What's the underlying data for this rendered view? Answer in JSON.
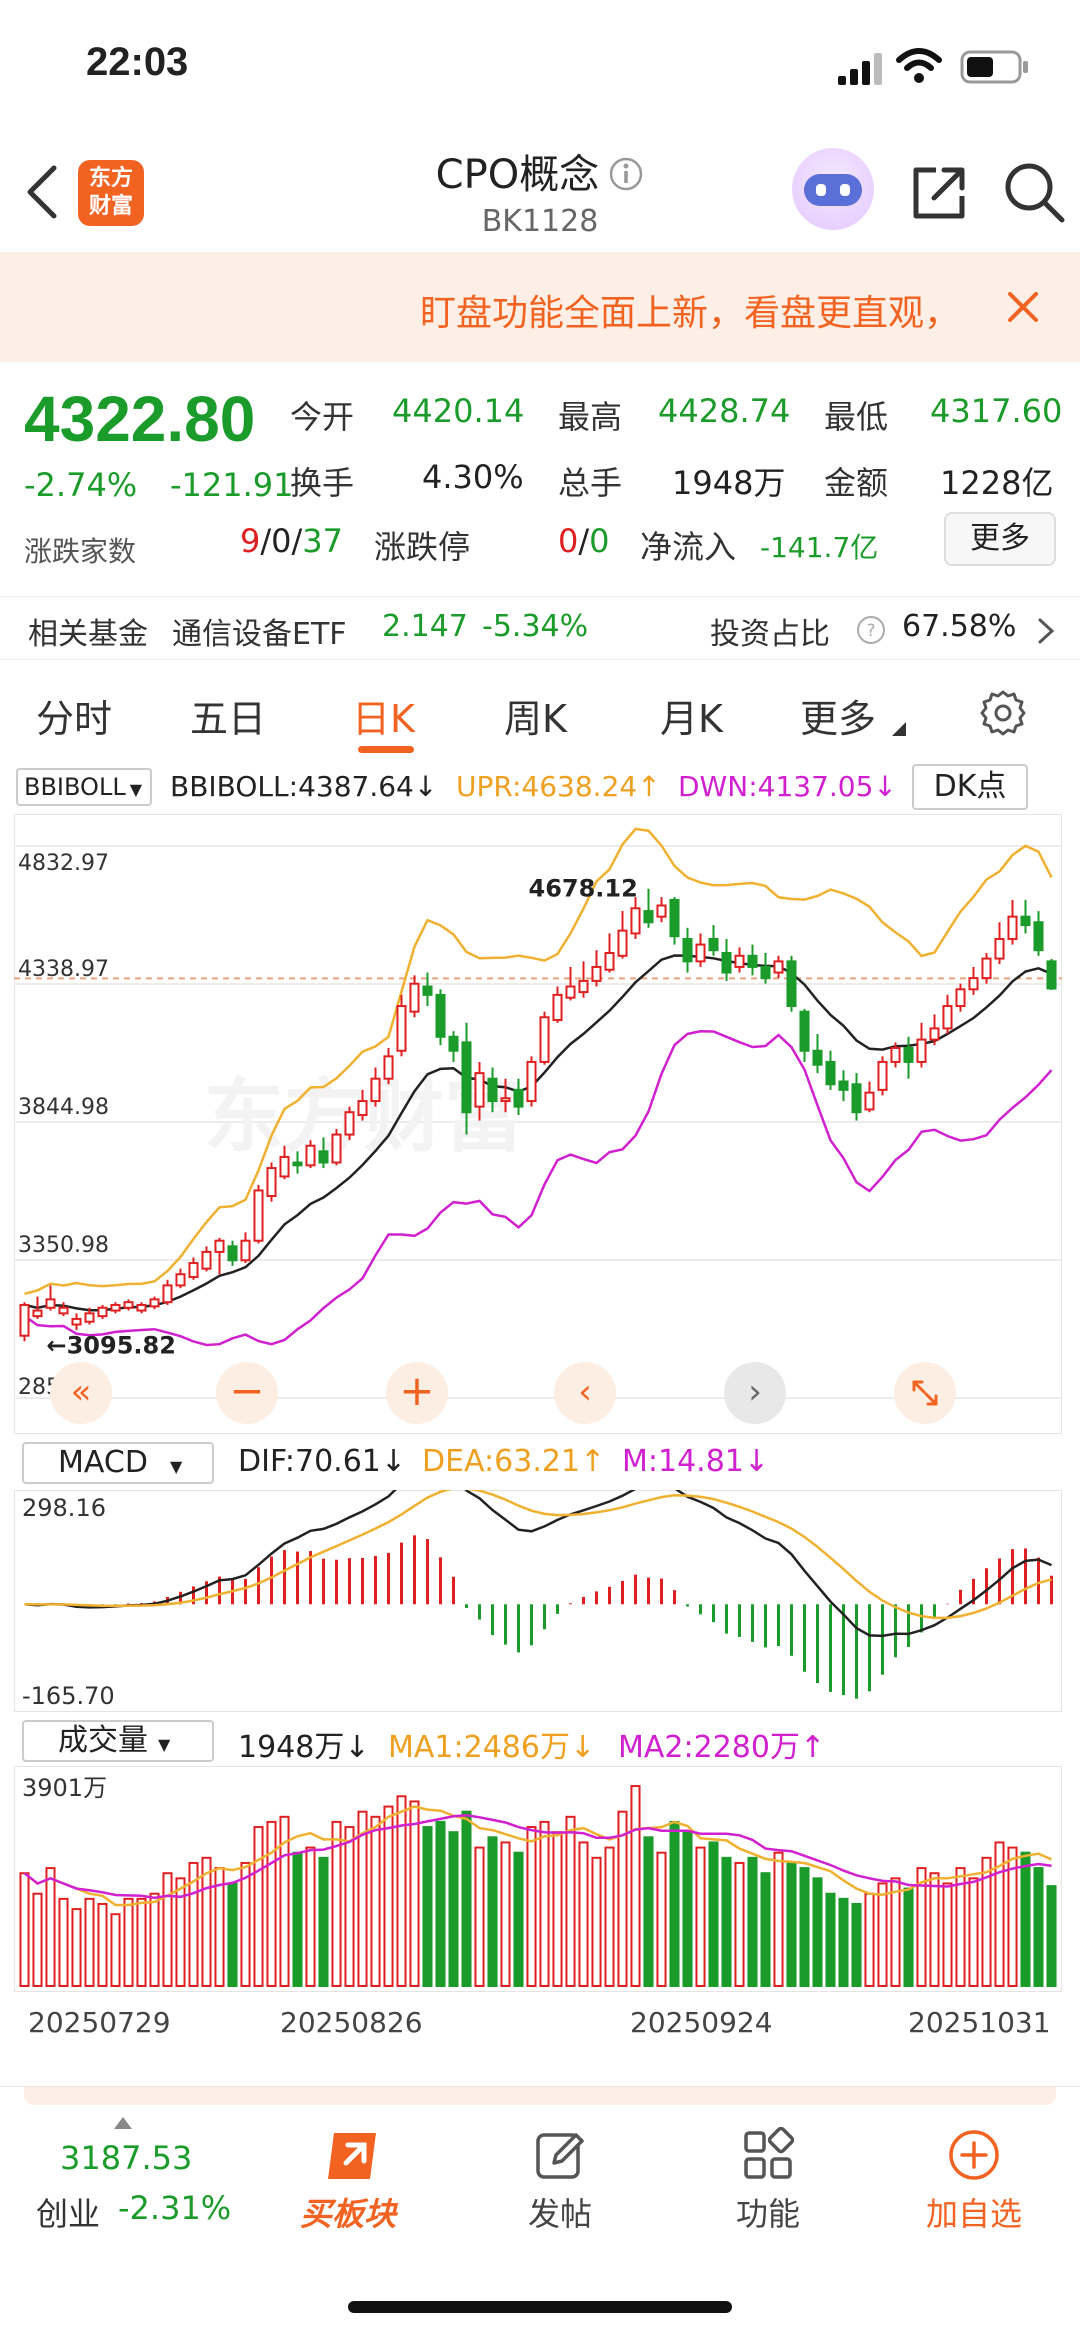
{
  "status_bar": {
    "time": "22:03"
  },
  "header": {
    "logo_text": "东方财富",
    "title": "CPO概念",
    "code": "BK1128"
  },
  "notice": {
    "text": "盯盘功能全面上新，看盘更直观，"
  },
  "quote": {
    "price": "4322.80",
    "change_pct": "-2.74%",
    "change": "-121.91",
    "open_label": "今开",
    "open": "4420.14",
    "high_label": "最高",
    "high": "4428.74",
    "low_label": "最低",
    "low": "4317.60",
    "turnover_label": "换手",
    "turnover": "4.30%",
    "volume_label": "总手",
    "volume": "1948万",
    "amount_label": "金额",
    "amount": "1228亿",
    "breadth_label": "涨跌家数",
    "breadth_up": "9",
    "breadth_flat": "0",
    "breadth_down": "37",
    "limit_label": "涨跌停",
    "limit_up": "0",
    "limit_down": "0",
    "inflow_label": "净流入",
    "inflow": "-141.7亿",
    "more_button": "更多"
  },
  "fund": {
    "label": "相关基金",
    "name": "通信设备ETF",
    "price": "2.147",
    "change": "-5.34%",
    "ratio_label": "投资占比",
    "ratio": "67.58%"
  },
  "tabs": [
    "分时",
    "五日",
    "日K",
    "周K",
    "月K",
    "更多"
  ],
  "active_tab": 2,
  "indicator": {
    "main_select": "BBIBOLL",
    "boll": "BBIBOLL:4387.64",
    "upr": "UPR:4638.24",
    "dwn": "DWN:4137.05",
    "dk_button": "DK点",
    "macd_select": "MACD",
    "dif": "DIF:70.61",
    "dea": "DEA:63.21",
    "m": "M:14.81",
    "vol_select": "成交量",
    "vol": "1948万",
    "ma1": "MA1:2486万",
    "ma2": "MA2:2280万"
  },
  "chart_data": {
    "type": "candlestick",
    "y_ticks": [
      "4832.97",
      "4338.97",
      "3844.98",
      "3350.98",
      "2856.98"
    ],
    "ylim": [
      2856.98,
      4832.97
    ],
    "high_marker": "4678.12",
    "low_marker": "3095.82",
    "macd_ticks": [
      "298.16",
      "-165.70"
    ],
    "volume_tick": "3901万",
    "x_labels": [
      "20250729",
      "20250826",
      "20250924",
      "20251031"
    ],
    "candles": [
      [
        3080,
        3190,
        3060,
        3200
      ],
      [
        3150,
        3170,
        3140,
        3220
      ],
      [
        3180,
        3210,
        3170,
        3260
      ],
      [
        3160,
        3180,
        3150,
        3200
      ],
      [
        3120,
        3140,
        3100,
        3160
      ],
      [
        3130,
        3160,
        3120,
        3180
      ],
      [
        3150,
        3180,
        3140,
        3190
      ],
      [
        3170,
        3190,
        3160,
        3200
      ],
      [
        3180,
        3200,
        3170,
        3210
      ],
      [
        3170,
        3190,
        3160,
        3200
      ],
      [
        3185,
        3210,
        3175,
        3220
      ],
      [
        3200,
        3260,
        3190,
        3280
      ],
      [
        3260,
        3300,
        3250,
        3320
      ],
      [
        3290,
        3340,
        3280,
        3360
      ],
      [
        3320,
        3380,
        3310,
        3400
      ],
      [
        3380,
        3420,
        3300,
        3430
      ],
      [
        3400,
        3350,
        3330,
        3420
      ],
      [
        3350,
        3420,
        3340,
        3450
      ],
      [
        3420,
        3600,
        3410,
        3620
      ],
      [
        3580,
        3680,
        3560,
        3700
      ],
      [
        3650,
        3720,
        3640,
        3760
      ],
      [
        3700,
        3690,
        3660,
        3740
      ],
      [
        3690,
        3760,
        3680,
        3780
      ],
      [
        3740,
        3700,
        3680,
        3790
      ],
      [
        3700,
        3800,
        3690,
        3820
      ],
      [
        3800,
        3880,
        3780,
        3900
      ],
      [
        3870,
        3920,
        3850,
        3960
      ],
      [
        3920,
        4000,
        3900,
        4040
      ],
      [
        4000,
        4080,
        3980,
        4110
      ],
      [
        4100,
        4260,
        4080,
        4300
      ],
      [
        4240,
        4340,
        4220,
        4370
      ],
      [
        4330,
        4300,
        4260,
        4380
      ],
      [
        4300,
        4150,
        4120,
        4320
      ],
      [
        4150,
        4100,
        4060,
        4170
      ],
      [
        4130,
        3880,
        3800,
        4200
      ],
      [
        3900,
        4020,
        3850,
        4060
      ],
      [
        4000,
        3920,
        3880,
        4040
      ],
      [
        3920,
        3930,
        3880,
        4000
      ],
      [
        3960,
        3900,
        3870,
        4000
      ],
      [
        3920,
        4060,
        3900,
        4080
      ],
      [
        4060,
        4220,
        4050,
        4240
      ],
      [
        4210,
        4300,
        4200,
        4330
      ],
      [
        4290,
        4330,
        4280,
        4400
      ],
      [
        4310,
        4350,
        4290,
        4420
      ],
      [
        4350,
        4400,
        4330,
        4460
      ],
      [
        4390,
        4450,
        4380,
        4520
      ],
      [
        4440,
        4530,
        4430,
        4600
      ],
      [
        4520,
        4610,
        4500,
        4650
      ],
      [
        4600,
        4560,
        4540,
        4680
      ],
      [
        4580,
        4620,
        4560,
        4650
      ],
      [
        4640,
        4510,
        4480,
        4650
      ],
      [
        4500,
        4420,
        4380,
        4540
      ],
      [
        4420,
        4480,
        4400,
        4520
      ],
      [
        4500,
        4460,
        4440,
        4550
      ],
      [
        4450,
        4380,
        4350,
        4500
      ],
      [
        4400,
        4440,
        4380,
        4470
      ],
      [
        4440,
        4400,
        4370,
        4480
      ],
      [
        4400,
        4360,
        4340,
        4450
      ],
      [
        4380,
        4420,
        4360,
        4440
      ],
      [
        4420,
        4260,
        4240,
        4440
      ],
      [
        4240,
        4100,
        4060,
        4250
      ],
      [
        4100,
        4050,
        4020,
        4160
      ],
      [
        4060,
        3980,
        3960,
        4100
      ],
      [
        3990,
        3960,
        3920,
        4030
      ],
      [
        3980,
        3880,
        3850,
        4020
      ],
      [
        3890,
        3950,
        3880,
        3990
      ],
      [
        3960,
        4060,
        3940,
        4080
      ],
      [
        4060,
        4110,
        4040,
        4130
      ],
      [
        4110,
        4060,
        4000,
        4150
      ],
      [
        4060,
        4140,
        4040,
        4200
      ],
      [
        4140,
        4180,
        4120,
        4230
      ],
      [
        4180,
        4260,
        4160,
        4300
      ],
      [
        4260,
        4320,
        4240,
        4340
      ],
      [
        4320,
        4360,
        4300,
        4400
      ],
      [
        4360,
        4430,
        4340,
        4450
      ],
      [
        4430,
        4500,
        4410,
        4560
      ],
      [
        4500,
        4580,
        4480,
        4640
      ],
      [
        4580,
        4550,
        4520,
        4640
      ],
      [
        4560,
        4460,
        4440,
        4600
      ],
      [
        4420,
        4322.8,
        4317.6,
        4428.74
      ]
    ],
    "volumes": [
      2200,
      1800,
      2300,
      1700,
      1500,
      1700,
      1600,
      1400,
      1700,
      1700,
      1800,
      2200,
      2100,
      2400,
      2500,
      2300,
      2000,
      2400,
      3100,
      3200,
      3300,
      2600,
      2700,
      2500,
      3200,
      3100,
      3400,
      3300,
      3500,
      3700,
      3600,
      3100,
      3200,
      3000,
      3400,
      2700,
      2900,
      2800,
      2600,
      3100,
      3200,
      3000,
      3300,
      2800,
      2500,
      2700,
      3400,
      3900,
      2900,
      2600,
      3200,
      3000,
      2700,
      2800,
      2500,
      2400,
      2500,
      2200,
      2600,
      2400,
      2300,
      2100,
      1800,
      1700,
      1600,
      1800,
      2000,
      2100,
      1900,
      2300,
      2200,
      2000,
      2300,
      2100,
      2500,
      2800,
      2700,
      2600,
      2300,
      1948
    ]
  },
  "bottom_nav": {
    "index_value": "3187.53",
    "index_name": "创业",
    "index_change": "-2.31%",
    "items": [
      "买板块",
      "发帖",
      "功能",
      "加自选"
    ]
  }
}
